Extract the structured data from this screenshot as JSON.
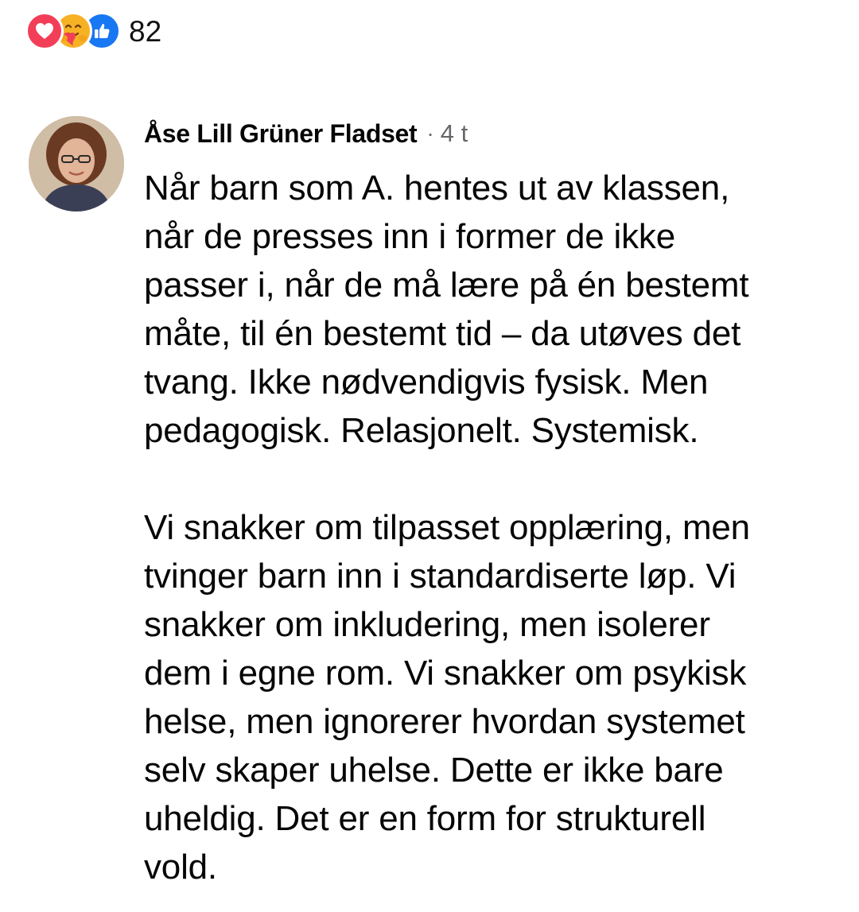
{
  "reactions": {
    "icons": [
      "love-icon",
      "care-icon",
      "like-icon"
    ],
    "count": "82",
    "colors": {
      "love": "#f33e58",
      "care": "#f7b125",
      "like": "#1877f2"
    }
  },
  "comment": {
    "author": "Åse Lill Grüner Fladset",
    "separator": "·",
    "time": "4 t",
    "paragraphs": [
      {
        "lines": [
          "Når barn som A. hentes ut av klassen,",
          "når de presses inn i former de ikke",
          "passer i, når de må lære på én bestemt",
          "måte, til én bestemt tid – da utøves det",
          "tvang. Ikke nødvendigvis fysisk. Men",
          "pedagogisk. Relasjonelt. Systemisk."
        ]
      },
      {
        "lines": [
          "Vi snakker om tilpasset opplæring, men",
          "tvinger barn inn i standardiserte løp. Vi",
          "snakker om inkludering, men isolerer",
          "dem i egne rom. Vi snakker om psykisk",
          "helse, men ignorerer hvordan systemet",
          "selv skaper uhelse. Dette er ikke bare",
          "uheldig. Det er en form for strukturell",
          "vold."
        ]
      }
    ]
  }
}
